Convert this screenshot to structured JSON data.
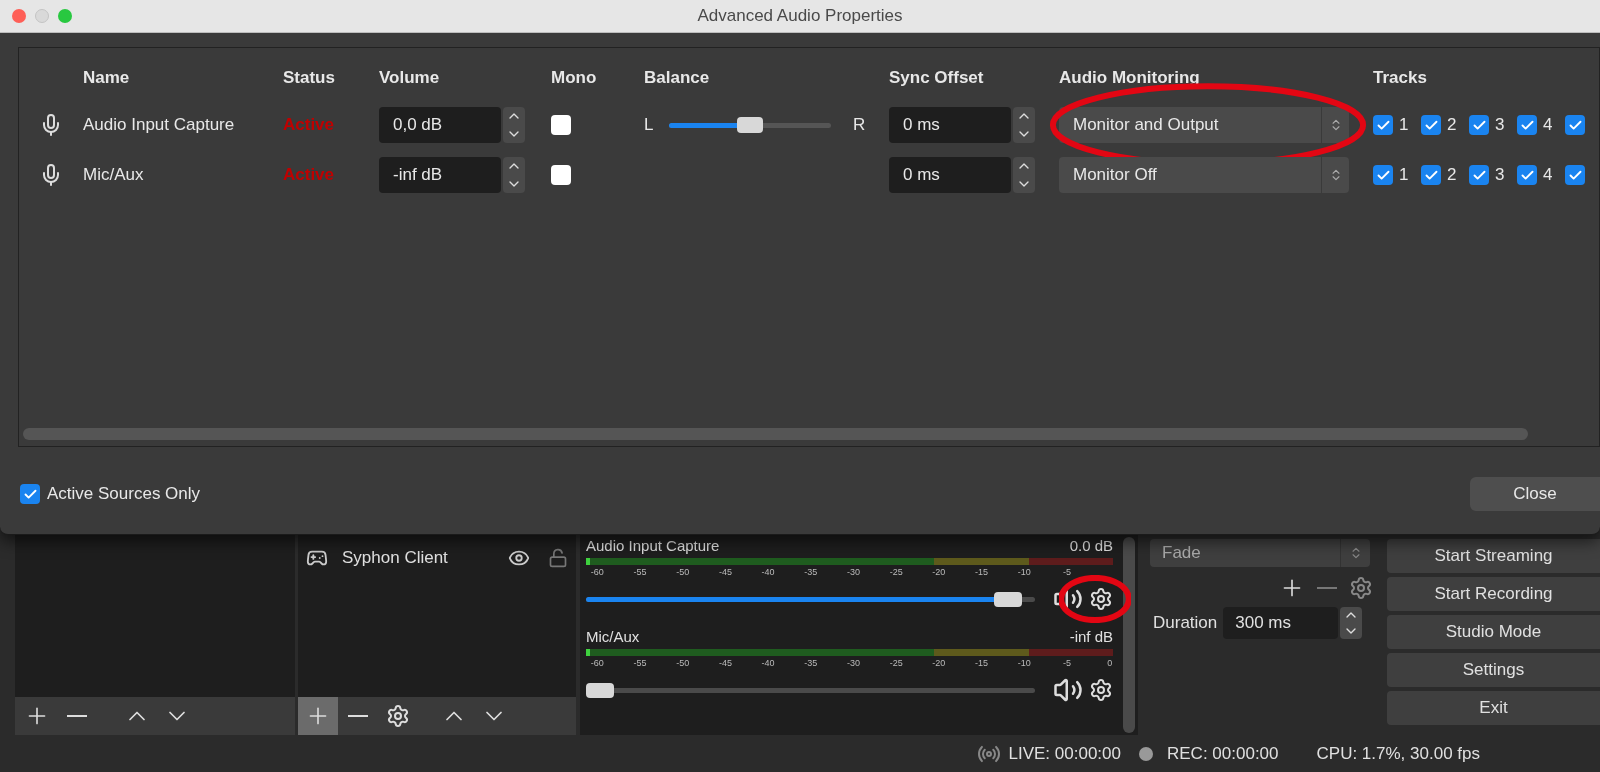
{
  "window": {
    "title": "Advanced Audio Properties"
  },
  "columns": [
    "Name",
    "Status",
    "Volume",
    "Mono",
    "Balance",
    "Sync Offset",
    "Audio Monitoring",
    "Tracks"
  ],
  "rows": [
    {
      "name": "Audio Input Capture",
      "status": "Active",
      "volume": "0,0 dB",
      "mono": false,
      "balance": {
        "left": "L",
        "right": "R",
        "level": 0.5
      },
      "sync_offset": "0 ms",
      "monitoring": "Monitor and Output",
      "circled": true,
      "tracks": [
        {
          "label": "1",
          "checked": true
        },
        {
          "label": "2",
          "checked": true
        },
        {
          "label": "3",
          "checked": true
        },
        {
          "label": "4",
          "checked": true
        },
        {
          "checked": true
        }
      ]
    },
    {
      "name": "Mic/Aux",
      "status": "Active",
      "volume": "-inf dB",
      "mono": false,
      "sync_offset": "0 ms",
      "monitoring": "Monitor Off",
      "circled": false,
      "tracks": [
        {
          "label": "1",
          "checked": true
        },
        {
          "label": "2",
          "checked": true
        },
        {
          "label": "3",
          "checked": true
        },
        {
          "label": "4",
          "checked": true
        },
        {
          "checked": true
        }
      ]
    }
  ],
  "active_sources_only": {
    "label": "Active Sources Only",
    "checked": true
  },
  "close_button": "Close",
  "sources": {
    "items": [
      {
        "name": "Syphon Client",
        "visible": true,
        "locked": false
      }
    ],
    "add_button_pressed": true
  },
  "mixer": {
    "channels": [
      {
        "name": "Audio Input Capture",
        "reading": "0.0 dB",
        "level": 0.97,
        "gear_circled": true,
        "scale": [
          "-60",
          "-55",
          "-50",
          "-45",
          "-40",
          "-35",
          "-30",
          "-25",
          "-20",
          "-15",
          "-10",
          "-5"
        ]
      },
      {
        "name": "Mic/Aux",
        "reading": "-inf dB",
        "level": 0,
        "gear_circled": false,
        "scale": [
          "-60",
          "-55",
          "-50",
          "-45",
          "-40",
          "-35",
          "-30",
          "-25",
          "-20",
          "-15",
          "-10",
          "-5",
          "0"
        ]
      }
    ]
  },
  "transitions": {
    "selected": "Fade",
    "duration_label": "Duration",
    "duration": "300 ms"
  },
  "controls": [
    "Start Streaming",
    "Start Recording",
    "Studio Mode",
    "Settings",
    "Exit"
  ],
  "status_bar": {
    "live": "LIVE: 00:00:00",
    "rec": "REC: 00:00:00",
    "cpu": "CPU: 1.7%, 30.00 fps"
  }
}
